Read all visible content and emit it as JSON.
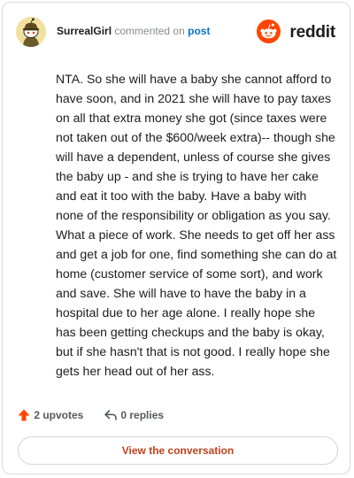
{
  "comment": {
    "username": "SurrealGirl",
    "commented_on_text": "commented on",
    "post_link_text": "post",
    "body": "NTA. So she will have a baby she cannot afford to have soon, and in 2021 she will have to pay taxes on all that extra money she got (since taxes were not taken out of the $600/week extra)-- though she will have a dependent, unless of course she gives the baby up - and she is trying to have her cake and eat it too with the baby. Have a baby with none of the responsibility or obligation as you say. What a piece of work. She needs to get off her ass and get a job for one, find something she can do at home (customer service of some sort), and work and save. She will have to have the baby in a hospital due to her age alone. I really hope she has been getting checkups and the baby is okay, but if she hasn't that is not good. I really hope she gets her head out of her ass.",
    "upvotes_label": "2 upvotes",
    "replies_label": "0 replies"
  },
  "brand": {
    "wordmark": "reddit",
    "icon": "reddit-snoo-icon",
    "accent_color": "#ff4500"
  },
  "footer": {
    "view_conversation_label": "View the conversation"
  },
  "icons": {
    "avatar": "snoo-avatar-icon",
    "upvote": "upvote-arrow-icon",
    "reply": "reply-arrow-icon"
  }
}
